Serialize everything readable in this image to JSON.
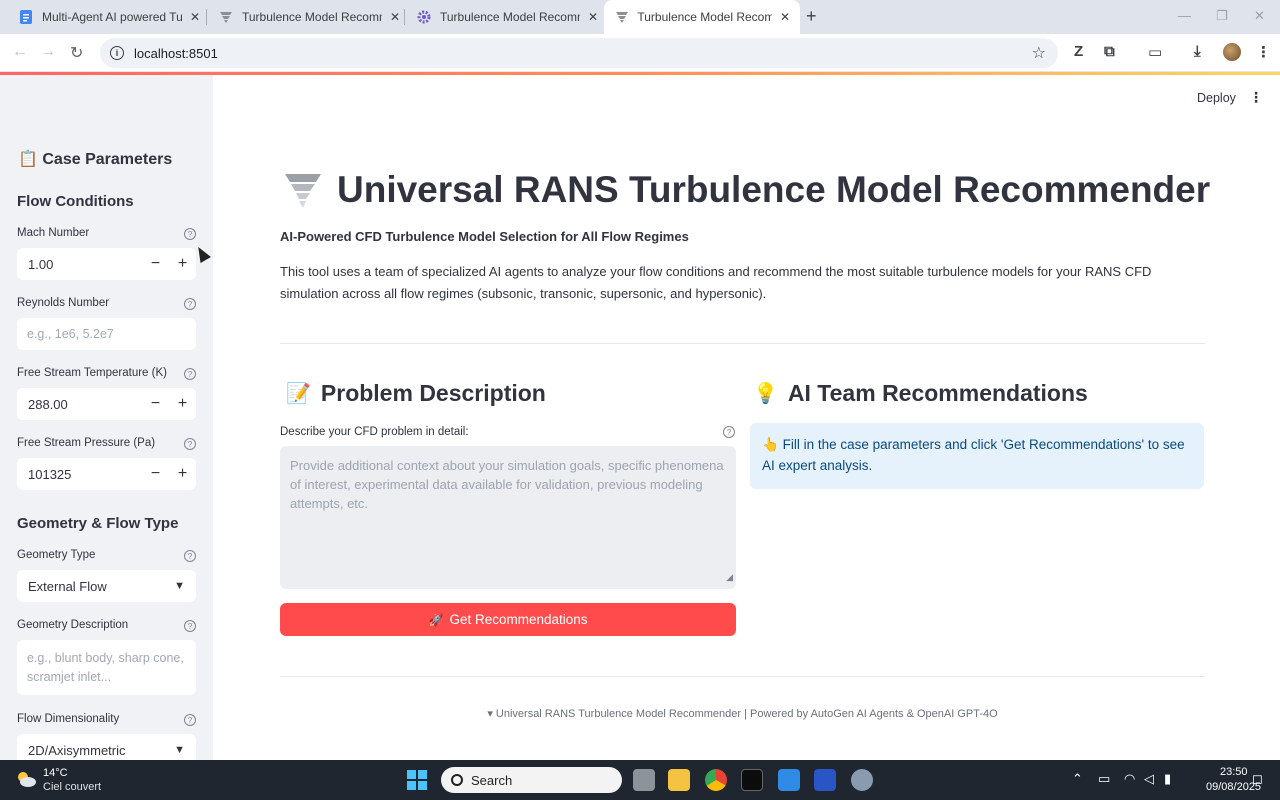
{
  "browser": {
    "tabs": [
      {
        "title": "Multi-Agent AI powered Turbul",
        "active": false
      },
      {
        "title": "Turbulence Model Recommend",
        "active": false
      },
      {
        "title": "Turbulence Model Recommend",
        "active": false
      },
      {
        "title": "Turbulence Model Recommend",
        "active": true
      }
    ],
    "url": "localhost:8501",
    "colors": {
      "tabbar": "#dfe3eb",
      "accent": "#ff4b4b"
    }
  },
  "header": {
    "deploy_label": "Deploy"
  },
  "sidebar": {
    "title": "Case Parameters",
    "flow_conditions": {
      "heading": "Flow Conditions",
      "mach": {
        "label": "Mach Number",
        "value": "1.00"
      },
      "reynolds": {
        "label": "Reynolds Number",
        "placeholder": "e.g., 1e6, 5.2e7"
      },
      "temperature": {
        "label": "Free Stream Temperature (K)",
        "value": "288.00"
      },
      "pressure": {
        "label": "Free Stream Pressure (Pa)",
        "value": "101325"
      }
    },
    "geometry": {
      "heading": "Geometry & Flow Type",
      "type": {
        "label": "Geometry Type",
        "value": "External Flow"
      },
      "description": {
        "label": "Geometry Description",
        "placeholder": "e.g., blunt body, sharp cone, scramjet inlet..."
      },
      "dimensionality": {
        "label": "Flow Dimensionality",
        "value": "2D/Axisymmetric"
      }
    }
  },
  "main": {
    "title": "Universal RANS Turbulence Model Recommender",
    "subtitle": "AI-Powered CFD Turbulence Model Selection for All Flow Regimes",
    "description": "This tool uses a team of specialized AI agents to analyze your flow conditions and recommend the most suitable turbulence models for your RANS CFD simulation across all flow regimes (subsonic, transonic, supersonic, and hypersonic).",
    "problem": {
      "heading": "Problem Description",
      "label": "Describe your CFD problem in detail:",
      "placeholder": "Provide additional context about your simulation goals, specific phenomena of interest, experimental data available for validation, previous modeling attempts, etc."
    },
    "button_label": "Get Recommendations",
    "recommendations": {
      "heading": "AI Team Recommendations",
      "info": "Fill in the case parameters and click 'Get Recommendations' to see AI expert analysis."
    },
    "footer": "Universal RANS Turbulence Model Recommender | Powered by AutoGen AI Agents & OpenAI GPT-4O"
  },
  "taskbar": {
    "weather_temp": "14°C",
    "weather_desc": "Ciel couvert",
    "search_label": "Search",
    "time": "23:50",
    "date": "09/08/2025"
  }
}
